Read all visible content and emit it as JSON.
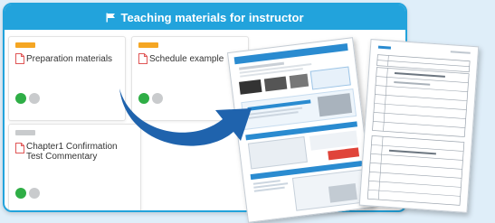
{
  "panel": {
    "title": "Teaching materials for instructor",
    "accent_color": "#22a3dc",
    "flag_icon": "flag-icon"
  },
  "cards": [
    {
      "tag_color": "#f5a623",
      "title": "Preparation materials",
      "icon": "document-icon",
      "buttons": [
        "green",
        "gray"
      ]
    },
    {
      "tag_color": "#f5a623",
      "title": "Schedule example",
      "icon": "document-icon",
      "buttons": [
        "green",
        "gray"
      ]
    },
    {
      "tag_color": "#c9cbcd",
      "title": "Chapter1 Confirmation Test Commentary",
      "icon": "document-icon",
      "buttons": [
        "green",
        "gray"
      ]
    }
  ],
  "arrow": {
    "color": "#1f63ad",
    "icon": "curved-arrow-icon"
  }
}
